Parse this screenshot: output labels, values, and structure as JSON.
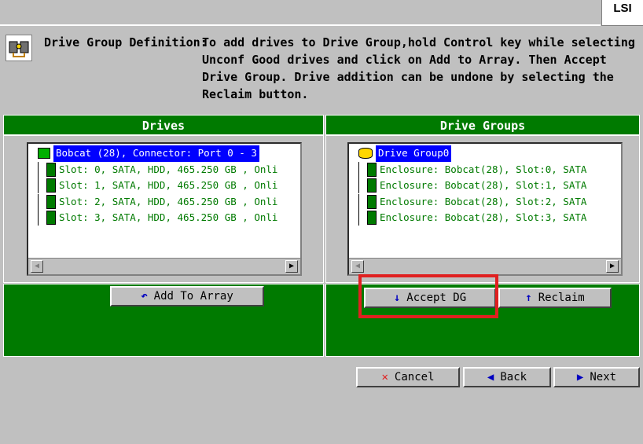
{
  "logo": {
    "text": "LSI"
  },
  "help": {
    "icon": "drive-config-icon",
    "label": "Drive Group Definition:",
    "text": "To add drives to Drive Group,hold Control key while selecting Unconf Good drives and click on Add to Array. Then Accept Drive Group. Drive addition can be undone by selecting the Reclaim button."
  },
  "drives_panel": {
    "header": "Drives",
    "items": [
      {
        "label": "Bobcat (28), Connector: Port 0 - 3",
        "icon": "controller-icon",
        "selected": true
      },
      {
        "label": "Slot: 0, SATA, HDD, 465.250 GB , Onli",
        "icon": "disk-icon"
      },
      {
        "label": "Slot: 1, SATA, HDD, 465.250 GB , Onli",
        "icon": "disk-icon"
      },
      {
        "label": "Slot: 2, SATA, HDD, 465.250 GB , Onli",
        "icon": "disk-icon"
      },
      {
        "label": "Slot: 3, SATA, HDD, 465.250 GB , Onli",
        "icon": "disk-icon"
      }
    ],
    "add_button": "Add To Array"
  },
  "groups_panel": {
    "header": "Drive Groups",
    "items": [
      {
        "label": "Drive Group0",
        "icon": "drive-group-icon",
        "selected": true
      },
      {
        "label": "Enclosure: Bobcat(28), Slot:0, SATA",
        "icon": "disk-icon"
      },
      {
        "label": "Enclosure: Bobcat(28), Slot:1, SATA",
        "icon": "disk-icon"
      },
      {
        "label": "Enclosure: Bobcat(28), Slot:2, SATA",
        "icon": "disk-icon"
      },
      {
        "label": "Enclosure: Bobcat(28), Slot:3, SATA",
        "icon": "disk-icon"
      }
    ],
    "accept_button": "Accept DG",
    "reclaim_button": "Reclaim"
  },
  "footer": {
    "cancel": "Cancel",
    "back": "Back",
    "next": "Next"
  },
  "colors": {
    "panel_green": "#007a00",
    "selection": "#0000ff",
    "highlight": "#e02020",
    "background": "#c0c0c0"
  }
}
